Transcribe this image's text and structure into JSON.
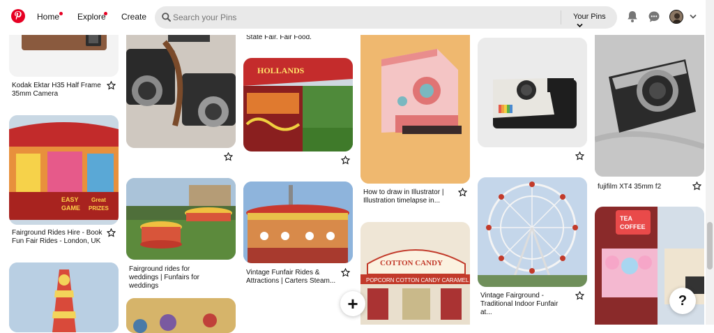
{
  "header": {
    "nav": {
      "home": "Home",
      "explore": "Explore",
      "create": "Create"
    },
    "search": {
      "placeholder": "Search your Pins"
    },
    "your_pins": "Your Pins"
  },
  "colors": {
    "brand": "#e60023"
  },
  "icons": [
    "pinterest-logo-icon",
    "search-icon",
    "chevron-down-icon",
    "bell-icon",
    "chat-icon",
    "star-icon",
    "plus-icon",
    "help-icon"
  ],
  "pins": {
    "c1a": "Kodak Ektar H35 Half Frame 35mm Camera",
    "c1b": "Fairground Rides Hire - Book Fun Fair Rides - London, UK",
    "c2a": "Fairground rides for weddings | Funfairs for weddings",
    "c3top": "State Fair. Fair Food.",
    "c3a": "Vintage Funfair Rides & Attractions | Carters Steam...",
    "c4a": "How to draw in Illustrator | Illustration timelapse in...",
    "c5a": "Vintage Fairground - Traditional Indoor Funfair at...",
    "c6a": "fujifilm XT4 35mm f2"
  },
  "fab": {
    "add": "+",
    "help": "?"
  }
}
